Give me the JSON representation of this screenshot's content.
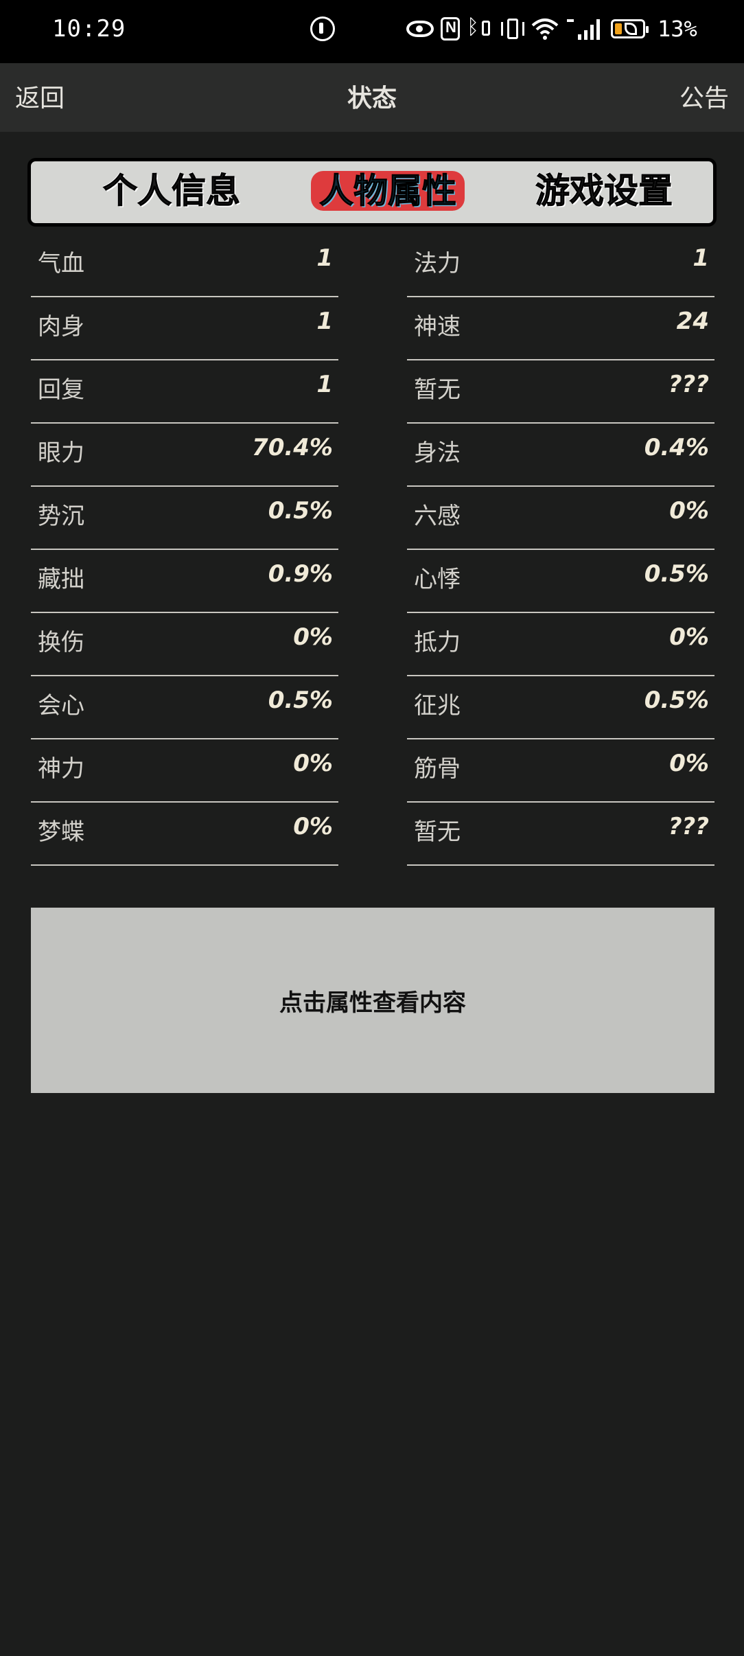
{
  "status_bar": {
    "time": "10:29",
    "battery_percent": "13%",
    "battery_level": 0.13,
    "icons": [
      "data-saver-icon",
      "eye-comfort-icon",
      "nfc-icon",
      "bluetooth-icon",
      "vibrate-icon",
      "wifi-icon",
      "signal-4g-icon",
      "battery-icon"
    ]
  },
  "header": {
    "back_label": "返回",
    "title": "状态",
    "notice_label": "公告"
  },
  "tabs": [
    {
      "label": "个人信息",
      "active": false
    },
    {
      "label": "人物属性",
      "active": true
    },
    {
      "label": "游戏设置",
      "active": false
    }
  ],
  "attributes": {
    "left": [
      {
        "name": "气血",
        "value": "1"
      },
      {
        "name": "肉身",
        "value": "1"
      },
      {
        "name": "回复",
        "value": "1"
      },
      {
        "name": "眼力",
        "value": "70.4%"
      },
      {
        "name": "势沉",
        "value": "0.5%"
      },
      {
        "name": "藏拙",
        "value": "0.9%"
      },
      {
        "name": "换伤",
        "value": "0%"
      },
      {
        "name": "会心",
        "value": "0.5%"
      },
      {
        "name": "神力",
        "value": "0%"
      },
      {
        "name": "梦蝶",
        "value": "0%"
      }
    ],
    "right": [
      {
        "name": "法力",
        "value": "1"
      },
      {
        "name": "神速",
        "value": "24"
      },
      {
        "name": "暂无",
        "value": "???"
      },
      {
        "name": "身法",
        "value": "0.4%"
      },
      {
        "name": "六感",
        "value": "0%"
      },
      {
        "name": "心悸",
        "value": "0.5%"
      },
      {
        "name": "抵力",
        "value": "0%"
      },
      {
        "name": "征兆",
        "value": "0.5%"
      },
      {
        "name": "筋骨",
        "value": "0%"
      },
      {
        "name": "暂无",
        "value": "???"
      }
    ]
  },
  "info_box": {
    "text": "点击属性查看内容"
  },
  "colors": {
    "background": "#1c1d1c",
    "header": "#2b2c2b",
    "tab_active_highlight": "#de3b3d",
    "info_box": "#c2c3c0"
  }
}
